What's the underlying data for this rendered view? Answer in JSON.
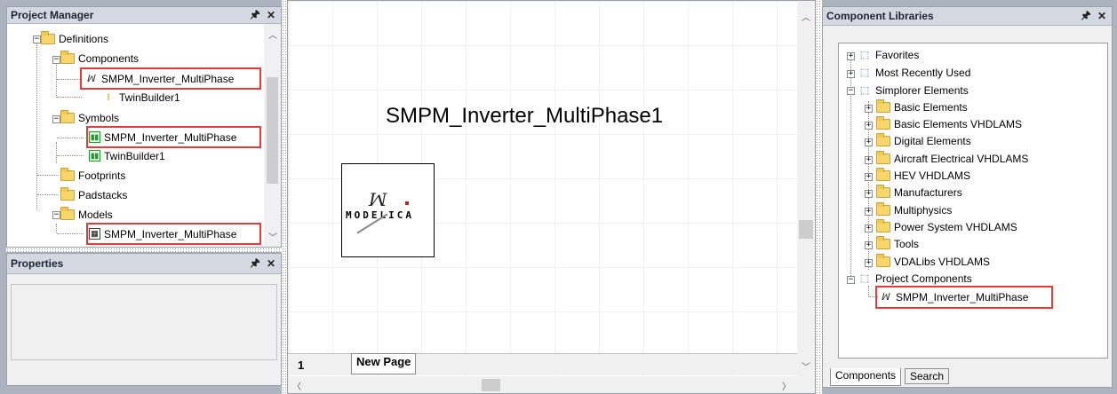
{
  "project_manager": {
    "title": "Project Manager",
    "pin_icon": "pin-icon",
    "close_icon": "close-icon",
    "items": {
      "definitions": "Definitions",
      "components": "Components",
      "comp_item1": "SMPM_Inverter_MultiPhase",
      "comp_item2": "TwinBuilder1",
      "symbols": "Symbols",
      "sym_item1": "SMPM_Inverter_MultiPhase",
      "sym_item2": "TwinBuilder1",
      "footprints": "Footprints",
      "padstacks": "Padstacks",
      "models": "Models",
      "model_item1": "SMPM_Inverter_MultiPhase"
    }
  },
  "properties": {
    "title": "Properties"
  },
  "schematic": {
    "title": "SMPM_Inverter_MultiPhase1",
    "logo_text": "MODELICA",
    "page_number": "1",
    "page_tab": "New Page"
  },
  "component_libraries": {
    "title": "Component Libraries",
    "items": {
      "favorites": "Favorites",
      "recent": "Most Recently Used",
      "simplorer": "Simplorer Elements",
      "basic": "Basic Elements",
      "basic_vhdl": "Basic Elements VHDLAMS",
      "digital": "Digital Elements",
      "aircraft": "Aircraft Electrical VHDLAMS",
      "hev": "HEV VHDLAMS",
      "manufacturers": "Manufacturers",
      "multiphysics": "Multiphysics",
      "power": "Power System VHDLAMS",
      "tools": "Tools",
      "vdalibs": "VDALibs VHDLAMS",
      "project": "Project Components",
      "project_item": "SMPM_Inverter_MultiPhase"
    },
    "tabs": {
      "components": "Components",
      "search": "Search"
    }
  },
  "colors": {
    "highlight": "#e53b3b",
    "folder": "#f7d66b",
    "symbol": "#1e9b2a"
  }
}
